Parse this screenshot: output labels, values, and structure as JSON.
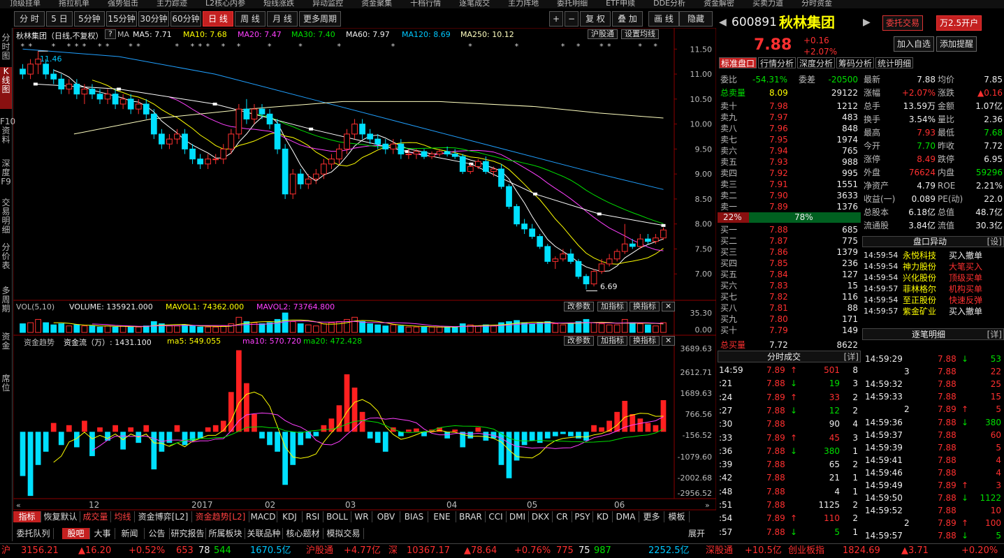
{
  "colors": {
    "up": "#ff3030",
    "down": "#00e000",
    "ma5": "#ffffff",
    "ma10": "#ffff00",
    "ma20": "#ff40ff",
    "ma30": "#00e000",
    "ma60": "#ffffff",
    "ma120": "#20a0ff",
    "ma250": "#ffffc0"
  },
  "top_menu": [
    "顶级挂单",
    "拖拉机单",
    "强势狙击",
    "主力踪迹",
    "L2核心内参",
    "短线涨跌",
    "异动监控",
    "资金聚集",
    "十档行情",
    "逐笔成交",
    "主力阵地",
    "委托明细",
    "ETF申赎",
    "DDE分析",
    "资金解密",
    "买卖力道",
    "分时资金"
  ],
  "period_tabs": [
    "分 时",
    "5 日",
    "5分钟",
    "15分钟",
    "30分钟",
    "60分钟",
    "日 线",
    "周 线",
    "月 线",
    "更多周期"
  ],
  "period_active": 6,
  "tool_buttons": {
    "plus": "+",
    "minus": "−",
    "restore": "复 权",
    "overlay": "叠 加",
    "draw": "画 线",
    "hide": "隐藏"
  },
  "left_nav": [
    "分时图",
    "K线图",
    "F10资料",
    "深度F9",
    "交易明细",
    "分价表",
    "多周期",
    "资金",
    "席位"
  ],
  "left_nav_active": 1,
  "kline_header": {
    "name": "秋林集团（日线,不复权）",
    "ma": "MA",
    "ma5": "MA5: 7.71",
    "ma10": "MA10: 7.68",
    "ma20": "MA20: 7.47",
    "ma30": "MA30: 7.40",
    "ma60": "MA60: 7.97",
    "ma120": "MA120: 8.69",
    "ma250": "MA250: 10.12",
    "btn1": "沪股通",
    "btn2": "设置均线"
  },
  "price_axis": [
    "11.50",
    "11.00",
    "10.50",
    "10.00",
    "9.50",
    "9.00",
    "8.50",
    "8.00",
    "7.50",
    "7.00"
  ],
  "annot_high": "11.46",
  "annot_low": "6.69",
  "vol_header": {
    "title": "VOL(5,10)",
    "vol": "VOLUME: 135921.000",
    "mavol1": "MAVOL1: 74362.000",
    "mavol2": "MAVOL2: 73764.800"
  },
  "vol_axis": [
    "35.30",
    "0.00"
  ],
  "fund_header": {
    "title": "资金趋势",
    "flow": "资金流（万）: 1431.100",
    "ma5": "ma5: 549.055",
    "ma10": "ma10: 570.720",
    "ma20": "ma20: 472.428"
  },
  "fund_axis": [
    "3689.63",
    "2612.71",
    "1689.63",
    "766.56",
    "-156.52",
    "-1079.60",
    "-2002.68",
    "-2956.52"
  ],
  "panel_btns": [
    "改参数",
    "加指标",
    "换指标"
  ],
  "date_axis": [
    "12",
    "2017",
    "02",
    "03",
    "04",
    "05",
    "06"
  ],
  "indicator_tabs": [
    "指标",
    "恢复默认",
    "成交量",
    "均线",
    "资金博弈[L2]",
    "资金趋势[L2]",
    "MACD",
    "KDJ",
    "RSI",
    "BOLL",
    "WR",
    "OBV",
    "BIAS",
    "ENE",
    "BRAR",
    "CCI",
    "DMI",
    "DKX",
    "CR",
    "PSY",
    "KD",
    "DMA",
    "更多",
    "模板"
  ],
  "bottom_tabs": [
    "委托队列",
    "股吧",
    "大事",
    "新闻",
    "公告",
    "研究报告",
    "所属板块",
    "关联品种",
    "核心题材",
    "模拟交易"
  ],
  "bottom_active": 1,
  "expand": "展开",
  "stock": {
    "code": "600891",
    "name": "秋林集团",
    "price": "7.88",
    "change": "+0.16",
    "pct": "+2.07%",
    "btn_order": "委托交易",
    "btn_open": "万2.5开户",
    "btn_fav": "加入自选",
    "btn_alert": "添加提醒"
  },
  "panel_tabs": [
    "标准盘口",
    "行情分析",
    "深度分析",
    "筹码分析",
    "统计明细"
  ],
  "weibi": {
    "label1": "委比",
    "v1": "-54.31%",
    "label2": "委差",
    "v2": "-20500"
  },
  "total_sell": {
    "label": "总卖量",
    "price": "8.09",
    "vol": "29122"
  },
  "asks": [
    [
      "卖十",
      "7.98",
      "1212"
    ],
    [
      "卖九",
      "7.97",
      "483"
    ],
    [
      "卖八",
      "7.96",
      "848"
    ],
    [
      "卖七",
      "7.95",
      "1974"
    ],
    [
      "卖六",
      "7.94",
      "765"
    ],
    [
      "卖五",
      "7.93",
      "988"
    ],
    [
      "卖四",
      "7.92",
      "995"
    ],
    [
      "卖三",
      "7.91",
      "1551"
    ],
    [
      "卖二",
      "7.90",
      "3633"
    ],
    [
      "卖一",
      "7.89",
      "1376"
    ]
  ],
  "ratio": {
    "left": "22%",
    "right": "78%",
    "left_frac": 0.22
  },
  "bids": [
    [
      "买一",
      "7.88",
      "685"
    ],
    [
      "买二",
      "7.87",
      "775"
    ],
    [
      "买三",
      "7.86",
      "1379"
    ],
    [
      "买四",
      "7.85",
      "236"
    ],
    [
      "买五",
      "7.84",
      "127"
    ],
    [
      "买六",
      "7.83",
      "15"
    ],
    [
      "买七",
      "7.82",
      "116"
    ],
    [
      "买八",
      "7.81",
      "88"
    ],
    [
      "买九",
      "7.80",
      "171"
    ],
    [
      "买十",
      "7.79",
      "149"
    ]
  ],
  "total_buy": {
    "label": "总买量",
    "price": "7.72",
    "vol": "8622"
  },
  "quote": [
    [
      "最新",
      "7.88",
      "均价",
      "7.85"
    ],
    [
      "涨幅",
      "+2.07%",
      "涨跌",
      "▲0.16"
    ],
    [
      "总手",
      "13.59万",
      "金额",
      "1.07亿"
    ],
    [
      "换手",
      "3.54%",
      "量比",
      "2.36"
    ],
    [
      "最高",
      "7.93",
      "最低",
      "7.68"
    ],
    [
      "今开",
      "7.70",
      "昨收",
      "7.72"
    ],
    [
      "涨停",
      "8.49",
      "跌停",
      "6.95"
    ],
    [
      "外盘",
      "76624",
      "内盘",
      "59296"
    ],
    [
      "净资产",
      "4.79",
      "ROE",
      "2.21%"
    ],
    [
      "收益(一)",
      "0.089",
      "PE(动)",
      "22.0"
    ],
    [
      "总股本",
      "6.18亿",
      "总值",
      "48.7亿"
    ],
    [
      "流通股",
      "3.84亿",
      "流值",
      "30.3亿"
    ]
  ],
  "abnormal": {
    "title": "盘口异动",
    "setting": "[设]",
    "rows": [
      [
        "14:59:54",
        "永悦科技",
        "买入撤单"
      ],
      [
        "14:59:54",
        "神力股份",
        "大笔买入"
      ],
      [
        "14:59:54",
        "兴化股份",
        "顶级买单"
      ],
      [
        "14:59:57",
        "菲林格尔",
        "机构买单"
      ],
      [
        "14:59:54",
        "至正股份",
        "快速反弹"
      ],
      [
        "14:59:57",
        "紫金矿业",
        "买入撤单"
      ]
    ]
  },
  "fenshi": {
    "title": "分时成交",
    "detail": "[详]",
    "rows": [
      [
        "14:59",
        "7.89",
        "↑",
        "501",
        "8"
      ],
      [
        ":21",
        "7.88",
        "↓",
        "19",
        "3"
      ],
      [
        ":24",
        "7.89",
        "↑",
        "33",
        "2"
      ],
      [
        ":27",
        "7.88",
        "↓",
        "12",
        "2"
      ],
      [
        ":30",
        "7.88",
        "",
        "90",
        "4"
      ],
      [
        ":33",
        "7.89",
        "↑",
        "45",
        "3"
      ],
      [
        ":36",
        "7.88",
        "↓",
        "380",
        "1"
      ],
      [
        ":39",
        "7.88",
        "",
        "65",
        "2"
      ],
      [
        ":42",
        "7.88",
        "",
        "21",
        "1"
      ],
      [
        ":48",
        "7.88",
        "",
        "4",
        "1"
      ],
      [
        ":51",
        "7.88",
        "",
        "1125",
        "2"
      ],
      [
        ":54",
        "7.89",
        "↑",
        "110",
        "2"
      ],
      [
        ":57",
        "7.88",
        "↓",
        "5",
        "1"
      ]
    ]
  },
  "zhubi": {
    "title": "逐笔明细",
    "detail": "[详]",
    "rows": [
      [
        "14:59:29",
        "7.88",
        "↓",
        "53"
      ],
      [
        "3",
        "7.88",
        "",
        "22"
      ],
      [
        "14:59:32",
        "7.88",
        "",
        "25"
      ],
      [
        "14:59:33",
        "7.88",
        "",
        "15"
      ],
      [
        "2",
        "7.89",
        "↑",
        "5"
      ],
      [
        "14:59:36",
        "7.88",
        "↓",
        "380"
      ],
      [
        "14:59:37",
        "7.88",
        "",
        "60"
      ],
      [
        "14:59:39",
        "7.88",
        "",
        "5"
      ],
      [
        "14:59:41",
        "7.88",
        "",
        "4"
      ],
      [
        "14:59:46",
        "7.88",
        "",
        "4"
      ],
      [
        "14:59:49",
        "7.89",
        "↑",
        "3"
      ],
      [
        "14:59:50",
        "7.88",
        "↓",
        "1122"
      ],
      [
        "14:59:52",
        "7.88",
        "",
        "10"
      ],
      [
        "2",
        "7.89",
        "↑",
        "100"
      ],
      [
        "14:59:57",
        "7.88",
        "↓",
        "5"
      ]
    ]
  },
  "status": {
    "sh": "沪",
    "sh_idx": "3156.21",
    "sh_chg": "▲16.20",
    "sh_pct": "+0.52%",
    "sh_cnt1": "653",
    "sh_cnt2": "78",
    "sh_cnt3": "544",
    "sh_amt": "1670.5亿",
    "hgt": "沪股通",
    "hgt_v": "+4.77亿",
    "sz": "深",
    "sz_idx": "10367.17",
    "sz_chg": "▲78.64",
    "sz_pct": "+0.76%",
    "sz_cnt1": "775",
    "sz_cnt2": "75",
    "sz_cnt3": "987",
    "sz_amt": "2252.5亿",
    "sgt": "深股通",
    "sgt_v": "+10.5亿",
    "cyb": "创业板指",
    "cyb_idx": "1824.69",
    "cyb_chg": "▲3.71",
    "cyb_pct": "+0.20%"
  },
  "chart_data": {
    "type": "candlestick",
    "title": "秋林集团（日线,不复权）",
    "ylim": [
      6.5,
      11.7
    ],
    "y_ticks": [
      11.5,
      11.0,
      10.5,
      10.0,
      9.5,
      9.0,
      8.5,
      8.0,
      7.5,
      7.0
    ],
    "x_ticks": [
      "12",
      "2017",
      "02",
      "03",
      "04",
      "05",
      "06"
    ],
    "ohlc": [
      [
        11.1,
        11.2,
        10.9,
        11.0
      ],
      [
        11.0,
        11.3,
        10.9,
        11.2
      ],
      [
        11.2,
        11.46,
        11.0,
        11.3
      ],
      [
        11.2,
        11.3,
        10.9,
        11.0
      ],
      [
        11.0,
        11.1,
        10.8,
        10.9
      ],
      [
        10.9,
        11.0,
        10.6,
        10.7
      ],
      [
        10.7,
        10.9,
        10.6,
        10.8
      ],
      [
        10.8,
        10.9,
        10.5,
        10.6
      ],
      [
        10.6,
        10.8,
        10.4,
        10.7
      ],
      [
        10.7,
        10.8,
        10.5,
        10.6
      ],
      [
        10.6,
        10.7,
        10.4,
        10.5
      ],
      [
        10.5,
        10.7,
        10.4,
        10.6
      ],
      [
        10.6,
        10.7,
        10.3,
        10.4
      ],
      [
        10.4,
        10.6,
        10.3,
        10.5
      ],
      [
        10.5,
        10.6,
        10.2,
        10.3
      ],
      [
        10.3,
        10.5,
        10.2,
        10.4
      ],
      [
        10.4,
        10.5,
        10.1,
        10.2
      ],
      [
        10.2,
        10.3,
        9.7,
        9.8
      ],
      [
        9.8,
        9.9,
        9.5,
        9.6
      ],
      [
        9.6,
        9.8,
        9.5,
        9.7
      ],
      [
        9.7,
        9.9,
        9.6,
        9.8
      ],
      [
        9.8,
        9.9,
        9.4,
        9.5
      ],
      [
        9.5,
        9.6,
        9.2,
        9.3
      ],
      [
        9.3,
        9.4,
        9.1,
        9.2
      ],
      [
        9.2,
        9.4,
        9.1,
        9.3
      ],
      [
        9.3,
        9.4,
        9.2,
        9.3
      ],
      [
        9.3,
        9.6,
        9.2,
        9.5
      ],
      [
        9.5,
        9.9,
        9.4,
        9.8
      ],
      [
        9.8,
        10.4,
        9.7,
        10.3
      ],
      [
        10.3,
        10.5,
        10.0,
        10.1
      ],
      [
        10.1,
        10.4,
        10.0,
        10.3
      ],
      [
        10.3,
        10.4,
        10.1,
        10.2
      ],
      [
        10.2,
        10.3,
        9.9,
        10.0
      ],
      [
        10.0,
        10.1,
        9.4,
        9.5
      ],
      [
        9.5,
        9.6,
        8.5,
        8.6
      ],
      [
        8.6,
        9.1,
        8.5,
        9.0
      ],
      [
        9.0,
        9.1,
        8.7,
        8.8
      ],
      [
        8.8,
        9.0,
        8.7,
        8.9
      ],
      [
        8.9,
        9.1,
        8.8,
        9.0
      ],
      [
        9.0,
        9.3,
        8.9,
        9.2
      ],
      [
        9.2,
        9.4,
        9.1,
        9.3
      ],
      [
        9.3,
        9.6,
        9.2,
        9.5
      ],
      [
        9.5,
        9.9,
        9.4,
        9.8
      ],
      [
        9.8,
        10.1,
        9.7,
        10.0
      ],
      [
        10.0,
        10.1,
        9.7,
        9.8
      ],
      [
        9.8,
        9.9,
        9.6,
        9.7
      ],
      [
        9.7,
        9.8,
        9.5,
        9.6
      ],
      [
        9.6,
        9.7,
        9.4,
        9.5
      ],
      [
        9.5,
        9.7,
        9.4,
        9.6
      ],
      [
        9.6,
        9.7,
        9.3,
        9.4
      ],
      [
        9.4,
        9.5,
        9.3,
        9.4
      ],
      [
        9.4,
        9.5,
        9.3,
        9.45
      ],
      [
        9.45,
        9.5,
        9.3,
        9.35
      ],
      [
        9.35,
        9.45,
        9.3,
        9.4
      ],
      [
        9.4,
        9.5,
        9.35,
        9.45
      ],
      [
        9.45,
        9.55,
        9.35,
        9.4
      ],
      [
        9.4,
        9.5,
        9.3,
        9.35
      ],
      [
        9.35,
        9.4,
        9.0,
        9.05
      ],
      [
        9.05,
        9.2,
        9.0,
        9.15
      ],
      [
        9.15,
        9.3,
        9.1,
        9.25
      ],
      [
        9.25,
        9.35,
        9.0,
        9.05
      ],
      [
        9.05,
        9.15,
        8.95,
        9.1
      ],
      [
        9.1,
        9.2,
        8.7,
        8.75
      ],
      [
        8.75,
        8.8,
        8.3,
        8.35
      ],
      [
        8.35,
        8.4,
        7.95,
        8.0
      ],
      [
        8.0,
        8.1,
        7.8,
        7.9
      ],
      [
        7.9,
        8.0,
        7.7,
        7.75
      ],
      [
        7.75,
        7.8,
        7.5,
        7.55
      ],
      [
        7.55,
        7.6,
        7.2,
        7.25
      ],
      [
        7.25,
        7.35,
        7.1,
        7.3
      ],
      [
        7.3,
        7.5,
        7.25,
        7.4
      ],
      [
        7.4,
        7.5,
        7.2,
        7.25
      ],
      [
        7.25,
        7.3,
        6.9,
        6.95
      ],
      [
        6.95,
        7.0,
        6.69,
        6.8
      ],
      [
        6.8,
        7.1,
        6.75,
        7.05
      ],
      [
        7.05,
        7.3,
        7.0,
        7.2
      ],
      [
        7.2,
        7.4,
        7.15,
        7.3
      ],
      [
        7.3,
        7.5,
        7.25,
        7.45
      ],
      [
        7.45,
        8.0,
        7.4,
        7.6
      ],
      [
        7.6,
        7.7,
        7.5,
        7.55
      ],
      [
        7.55,
        7.8,
        7.5,
        7.7
      ],
      [
        7.7,
        7.8,
        7.6,
        7.65
      ],
      [
        7.65,
        7.8,
        7.6,
        7.72
      ],
      [
        7.72,
        7.93,
        7.68,
        7.88
      ]
    ],
    "volume": [
      8,
      9,
      12,
      9,
      7,
      8,
      6,
      7,
      6,
      6,
      5,
      6,
      5,
      6,
      5,
      5,
      6,
      10,
      8,
      6,
      6,
      7,
      6,
      5,
      5,
      5,
      6,
      8,
      14,
      10,
      9,
      8,
      9,
      12,
      18,
      10,
      8,
      7,
      6,
      8,
      9,
      10,
      12,
      14,
      10,
      8,
      7,
      6,
      7,
      6,
      5,
      5,
      5,
      5,
      5,
      5,
      5,
      8,
      7,
      6,
      7,
      6,
      9,
      10,
      11,
      9,
      8,
      9,
      10,
      8,
      7,
      8,
      10,
      12,
      9,
      8,
      7,
      7,
      12,
      9,
      8,
      7,
      6,
      9
    ],
    "fund_flow": [
      -2000,
      -2900,
      -1500,
      -900,
      400,
      -600,
      300,
      -700,
      500,
      -1100,
      200,
      -400,
      300,
      -800,
      200,
      -500,
      300,
      -1700,
      -900,
      -500,
      300,
      -600,
      -400,
      -300,
      200,
      300,
      500,
      1800,
      3689,
      2200,
      800,
      -300,
      -600,
      -900,
      -2400,
      -1500,
      -600,
      -300,
      -200,
      300,
      600,
      1200,
      2600,
      2000,
      900,
      -300,
      -500,
      -900,
      200,
      -200,
      100,
      150,
      -200,
      100,
      200,
      -300,
      100,
      -700,
      -300,
      200,
      -400,
      -300,
      -1500,
      -2100,
      -1300,
      -600,
      -400,
      -500,
      -300,
      -200,
      -100,
      -200,
      -300,
      -400,
      300,
      200,
      500,
      900,
      1400,
      800,
      600,
      400,
      300,
      1431
    ]
  }
}
